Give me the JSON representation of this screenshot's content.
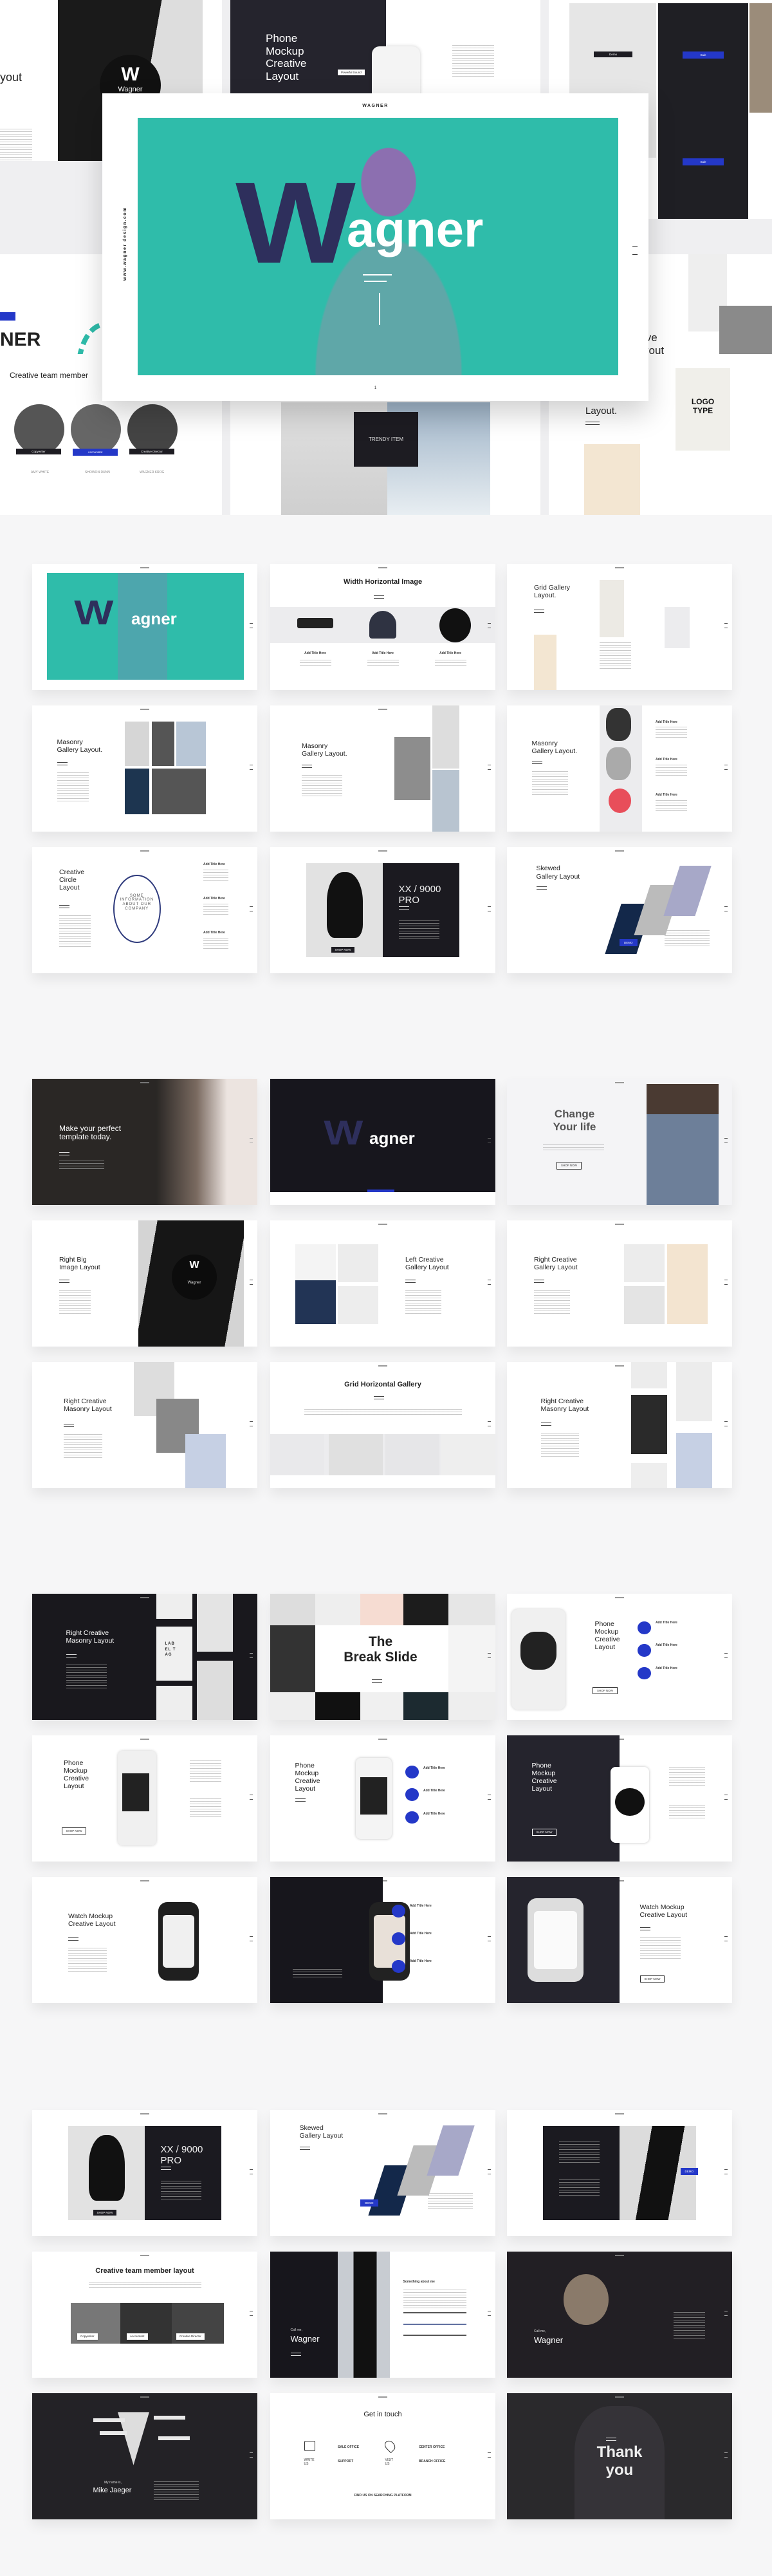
{
  "colors": {
    "accent_teal": "#2fbcaa",
    "logo_navy": "#2e2f5c",
    "accent_blue": "#2438c8",
    "dark": "#1d1c22",
    "page_bg": "#f6f6f7"
  },
  "hero": {
    "main": {
      "brand": "WAGNER",
      "side_url": "www.wagner design.com",
      "logo_mark": "W",
      "logo_text": "agner",
      "page": "1"
    },
    "collage": {
      "tile_a_title": "yout",
      "tile_a_badge": "Wagner",
      "tile_a_badge_mark": "W",
      "phone_title": "Phone\nMockup\nCreative\nLayout",
      "phone_tags": [
        "Powerful Sound",
        "Extended Battery",
        "Ice Cube"
      ],
      "demo": "Demo",
      "sale": [
        "Sale",
        "Sale"
      ],
      "banner_title": "NER\nCTION",
      "right_title": "ive\nyout",
      "team_title": "Creative team member",
      "team_roles": [
        "Copywriter",
        "Accountant",
        "Creative Director"
      ],
      "team_names": [
        "AMY WHITE",
        "SHOWON DUNN",
        "WAGNER KROG"
      ],
      "trendy": "TRENDY ITEM",
      "layout_title": "Layout.",
      "tshirt": "LOGO\nTYPE"
    }
  },
  "sections": [
    {
      "slides": [
        {
          "logo_mark": "W",
          "logo_text": "agner"
        },
        {
          "title": "Width Horizontal Image",
          "captions": [
            "Add Title Here",
            "Add Title Here",
            "Add Title Here"
          ]
        },
        {
          "title": "Grid Gallery\nLayout."
        },
        {
          "title": "Masonry\nGallery Layout."
        },
        {
          "title": "Masonry\nGallery Layout."
        },
        {
          "title": "Masonry\nGallery Layout.",
          "items": [
            "Add Title Here",
            "Add Title Here",
            "Add Title Here"
          ]
        },
        {
          "title": "Creative\nCircle\nLayout",
          "circle_text": "SOME\nINFORMATION\nABOUT OUR\nCOMPANY",
          "items": [
            "Add Title Here",
            "Add Title Here",
            "Add Title Here"
          ]
        },
        {
          "title": "XX / 9000\nPRO",
          "button": "SHOP NOW"
        },
        {
          "title": "Skewed\nGallery Layout",
          "button": "DEMO"
        }
      ]
    },
    {
      "slides": [
        {
          "title": "Make your perfect\ntemplate today."
        },
        {
          "logo_mark": "W",
          "logo_text": "agner"
        },
        {
          "title": "Change\nYour life",
          "button": "SHOP NOW"
        },
        {
          "title": "Right Big\nImage Layout",
          "badge": "Wagner",
          "badge_mark": "W"
        },
        {
          "title": "Left Creative\nGallery Layout"
        },
        {
          "title": "Right Creative\nGallery Layout"
        },
        {
          "title": "Right Creative\nMasonry Layout"
        },
        {
          "title": "Grid Horizontal Gallery"
        },
        {
          "title": "Right Creative\nMasonry Layout"
        }
      ]
    },
    {
      "slides": [
        {
          "title": "Right Creative\nMasonry Layout",
          "tag": "LABEL TAG"
        },
        {
          "title": "The\nBreak Slide"
        },
        {
          "title": "Phone\nMockup\nCreative\nLayout",
          "items": [
            "Add Title Here",
            "Add Title Here",
            "Add Title Here"
          ],
          "button": "SHOP NOW"
        },
        {
          "title": "Phone\nMockup\nCreative\nLayout",
          "button": "SHOP NOW"
        },
        {
          "title": "Phone\nMockup\nCreative\nLayout",
          "items": [
            "Add Title Here",
            "Add Title Here",
            "Add Title Here"
          ]
        },
        {
          "title": "Phone\nMockup\nCreative\nLayout",
          "button": "SHOP NOW"
        },
        {
          "title": "Watch Mockup\nCreative Layout"
        },
        {
          "items": [
            "Add Title Here",
            "Add Title Here",
            "Add Title Here"
          ]
        },
        {
          "title": "Watch Mockup\nCreative Layout",
          "button": "SHOP NOW"
        }
      ]
    },
    {
      "slides": [
        {
          "title": "XX / 9000\nPRO",
          "button": "SHOP NOW"
        },
        {
          "title": "Skewed\nGallery Layout",
          "button": "DEMO"
        },
        {
          "button": "DEMO"
        },
        {
          "title": "Creative team member layout",
          "roles": [
            "Copywriter",
            "Accountant",
            "Creative Director"
          ]
        },
        {
          "call_label": "Call me,",
          "name": "Wagner",
          "about": "Something about me"
        },
        {
          "call_label": "Call me,",
          "name": "Wagner"
        },
        {
          "call_label": "My name is,",
          "name": "Mike Jaeger"
        },
        {
          "title": "Get in touch",
          "write_us": "WRITE\nUS",
          "visit_us": "VISIT\nUS",
          "sale_office": "SALE OFFICE",
          "support": "SUPPORT",
          "center_office": "CENTER OFFICE",
          "branch_office": "BRANCH OFFICE",
          "find_us": "FIND US ON SEARCHING PLATFORM"
        },
        {
          "title": "Thank\nyou"
        }
      ]
    }
  ]
}
